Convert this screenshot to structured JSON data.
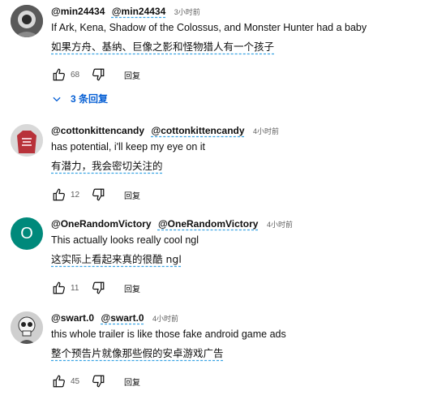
{
  "comments": [
    {
      "author": "@min24434",
      "mention": "@min24434",
      "time": "3小时前",
      "text": "If Ark, Kena, Shadow of the Colossus, and Monster Hunter had a baby",
      "translation": "如果方舟、基纳、巨像之影和怪物猎人有一个孩子",
      "likes": "68",
      "reply_label": "回复",
      "avatar": {
        "kind": "photo-icon",
        "color": "#4a4a4a"
      }
    },
    {
      "author": "@cottonkittencandy",
      "mention": "@cottonkittencandy",
      "time": "4小时前",
      "text": "has potential, i'll keep my eye on it",
      "translation": "有潜力，我会密切关注的",
      "likes": "12",
      "reply_label": "回复",
      "avatar": {
        "kind": "shirt-icon",
        "color": "#b8323a"
      }
    },
    {
      "author": "@OneRandomVictory",
      "mention": "@OneRandomVictory",
      "time": "4小时前",
      "text": "This actually looks really cool ngl",
      "translation": "这实际上看起来真的很酷 ngl",
      "likes": "11",
      "reply_label": "回复",
      "avatar": {
        "kind": "letter",
        "letter": "O",
        "color": "#00897b"
      }
    },
    {
      "author": "@swart.0",
      "mention": "@swart.0",
      "time": "4小时前",
      "text": "this whole trailer is like those fake android game ads",
      "translation": "整个预告片就像那些假的安卓游戏广告",
      "likes": "45",
      "reply_label": "回复",
      "avatar": {
        "kind": "skull-icon",
        "color": "#d9d9d9"
      }
    }
  ],
  "replies_toggle": {
    "label": "3 条回复",
    "icon": "chevron-down-icon"
  },
  "colors": {
    "link": "#065fd4",
    "secondary": "#606060",
    "underline": "#3aa3e3"
  }
}
